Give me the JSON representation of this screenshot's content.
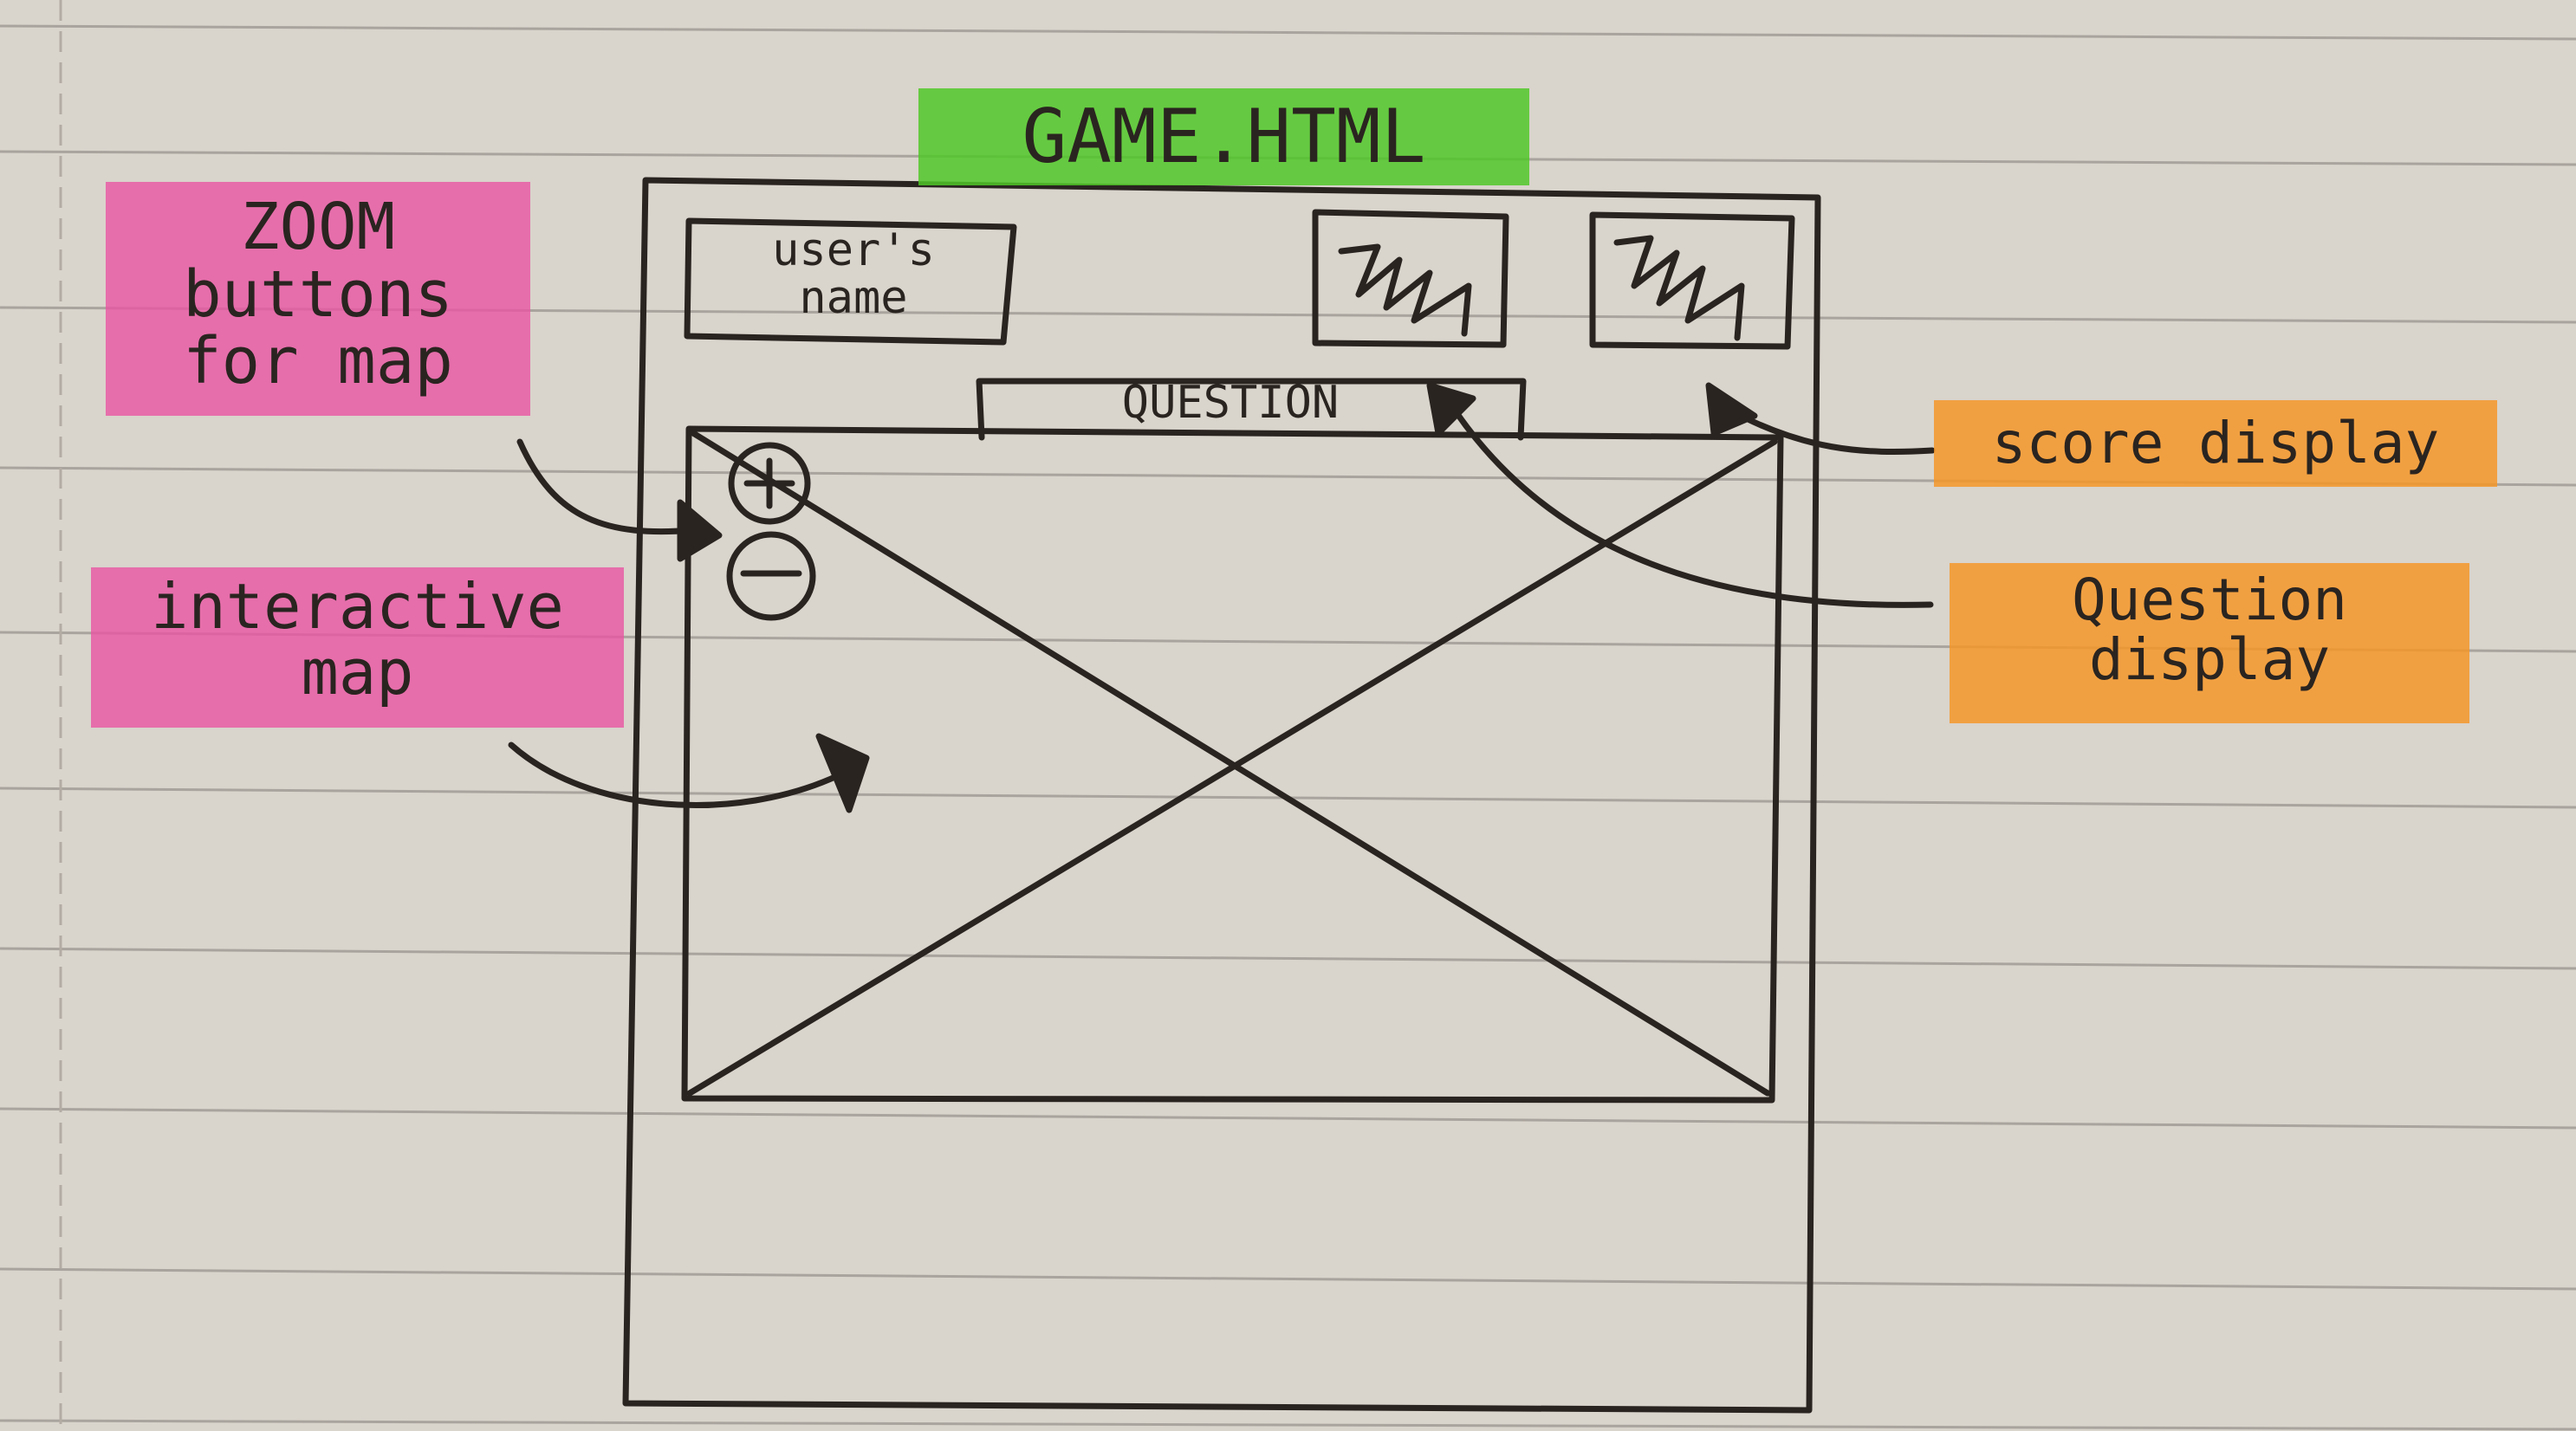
{
  "title": "GAME.HTML",
  "wireframe": {
    "username_box": "user's\nname",
    "question_box": "QUESTION",
    "zoom_in_symbol": "+",
    "zoom_out_symbol": "−"
  },
  "annotations": {
    "zoom_buttons": "ZOOM\nbuttons\nfor map",
    "interactive_map": "interactive\nmap",
    "score_display": "score display",
    "question_display": "Question\ndisplay"
  },
  "colors": {
    "pink_highlight": "#e854a2",
    "green_highlight": "#50c828",
    "orange_highlight": "#f59628",
    "ink": "#2a2420",
    "paper": "#d9d4cc"
  }
}
